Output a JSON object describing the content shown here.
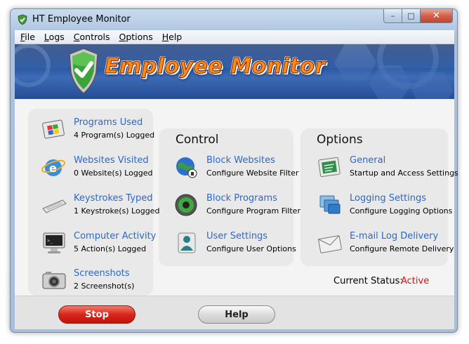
{
  "window": {
    "title": "HT Employee Monitor",
    "controls": {
      "minimize": "–",
      "maximize": "□",
      "close": "✕"
    }
  },
  "menu": [
    "File",
    "Logs",
    "Controls",
    "Options",
    "Help"
  ],
  "banner": {
    "title": "Employee Monitor",
    "logo_icon": "shield-check-icon"
  },
  "logs": [
    {
      "label": "Programs Used",
      "sub": "4 Program(s) Logged",
      "icon": "programs-window-icon"
    },
    {
      "label": "Websites Visited",
      "sub": "0 Website(s) Logged",
      "icon": "internet-explorer-icon"
    },
    {
      "label": "Keystrokes Typed",
      "sub": "1 Keystroke(s) Logged",
      "icon": "keyboard-icon"
    },
    {
      "label": "Computer Activity",
      "sub": "5 Action(s) Logged",
      "icon": "monitor-icon"
    },
    {
      "label": "Screenshots",
      "sub": "2 Screenshot(s)",
      "icon": "camera-icon"
    }
  ],
  "control": {
    "title": "Control",
    "items": [
      {
        "label": "Block Websites",
        "sub": "Configure Website Filter",
        "icon": "globe-lock-icon"
      },
      {
        "label": "Block Programs",
        "sub": "Configure Program Filter",
        "icon": "disc-block-icon"
      },
      {
        "label": "User Settings",
        "sub": "Configure User Options",
        "icon": "user-icon"
      }
    ]
  },
  "options": {
    "title": "Options",
    "items": [
      {
        "label": "General",
        "sub": "Startup and Access Settings",
        "icon": "general-settings-icon"
      },
      {
        "label": "Logging Settings",
        "sub": "Configure Logging Options",
        "icon": "logging-windows-icon"
      },
      {
        "label": "E-mail Log Delivery",
        "sub": "Configure Remote Delivery",
        "icon": "envelope-icon"
      }
    ]
  },
  "status": {
    "label": "Current Status:",
    "value": "Active",
    "value_color": "#e01010"
  },
  "buttons": {
    "stop": "Stop",
    "help": "Help"
  }
}
